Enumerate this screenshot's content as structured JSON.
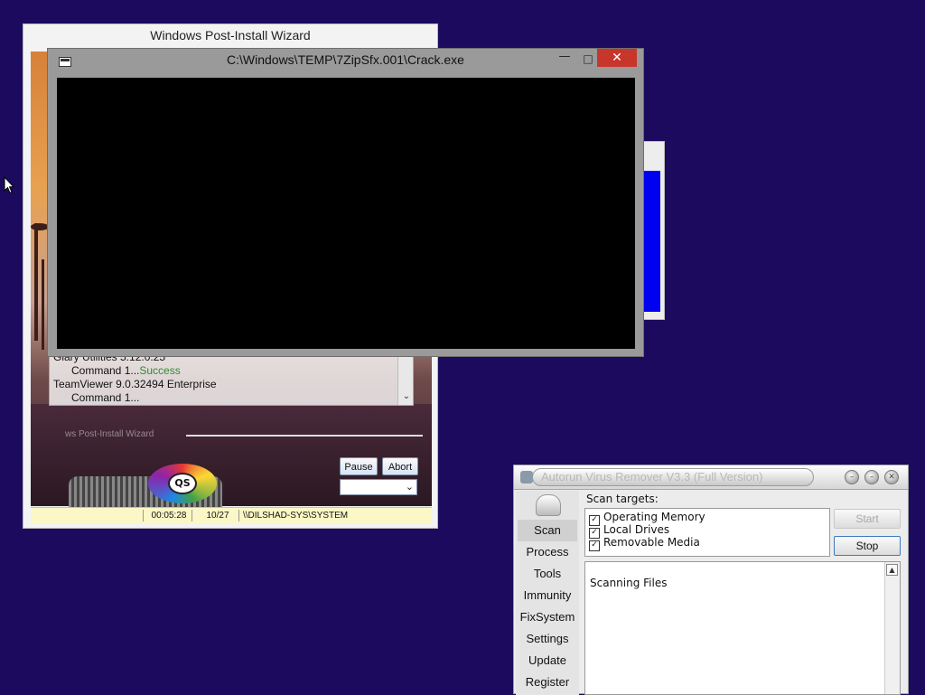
{
  "wizard": {
    "title": "Windows Post-Install Wizard",
    "log": [
      {
        "text": "Glary Utilities 5.12.0.25",
        "indent": false
      },
      {
        "text": "Command 1...",
        "status": "Success",
        "indent": true
      },
      {
        "text": "TeamViewer 9.0.32494 Enterprise",
        "indent": false
      },
      {
        "text": "Command 1...",
        "indent": true
      }
    ],
    "faint_label": "ws Post-Install Wizard",
    "logo_text": "QS",
    "pause_label": "Pause",
    "abort_label": "Abort",
    "status": {
      "elapsed": "00:05:28",
      "progress": "10/27",
      "user": "\\\\DILSHAD-SYS\\SYSTEM"
    }
  },
  "console": {
    "title": "C:\\Windows\\TEMP\\7ZipSfx.001\\Crack.exe",
    "minimize_glyph": "—",
    "maximize_glyph": "□",
    "close_glyph": "✕"
  },
  "avr": {
    "title": "Autorun Virus Remover V3.3 (Full Version)",
    "sidebar": [
      "Scan",
      "Process",
      "Tools",
      "Immunity",
      "FixSystem",
      "Settings",
      "Update",
      "Register"
    ],
    "scan_targets_label": "Scan targets:",
    "targets": [
      {
        "label": "Operating Memory",
        "checked": true
      },
      {
        "label": "Local Drives",
        "checked": true
      },
      {
        "label": "Removable Media",
        "checked": true
      }
    ],
    "start_label": "Start",
    "stop_label": "Stop",
    "log_text": "Scanning Files"
  },
  "colors": {
    "desktop": "#1b0a5e",
    "console_close": "#c7352b",
    "success": "#2e8b2e",
    "blue_window": "#0000f0"
  }
}
